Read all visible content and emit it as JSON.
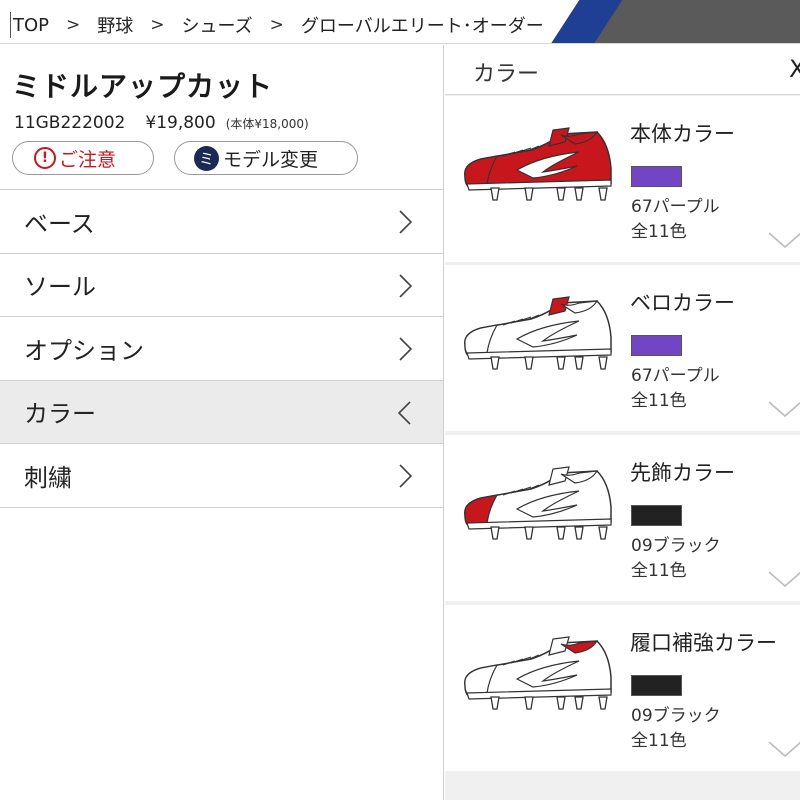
{
  "breadcrumb": [
    "TOP",
    "野球",
    "シューズ",
    "グローバルエリート･オーダー"
  ],
  "breadcrumb_separator": ">",
  "product": {
    "name": "ミドルアップカット",
    "code": "11GB222002",
    "price": "¥19,800",
    "base_price": "(本体¥18,000)"
  },
  "buttons": {
    "caution_label": "ご注意",
    "caution_icon": "!",
    "model_change_label": "モデル変更",
    "model_icon": "ミ"
  },
  "menu": {
    "items": [
      {
        "label": "ベース",
        "expanded": false
      },
      {
        "label": "ソール",
        "expanded": false
      },
      {
        "label": "オプション",
        "expanded": false
      },
      {
        "label": "カラー",
        "expanded": true
      },
      {
        "label": "刺繍",
        "expanded": false
      }
    ]
  },
  "panel": {
    "title": "カラー",
    "close_icon": "X"
  },
  "color_parts": [
    {
      "title": "本体カラー",
      "swatch_name": "67パープル",
      "swatch_color": "#7345c4",
      "count": "全11色",
      "highlight": "body"
    },
    {
      "title": "ベロカラー",
      "swatch_name": "67パープル",
      "swatch_color": "#7345c4",
      "count": "全11色",
      "highlight": "tongue"
    },
    {
      "title": "先飾カラー",
      "swatch_name": "09ブラック",
      "swatch_color": "#222222",
      "count": "全11色",
      "highlight": "toe"
    },
    {
      "title": "履口補強カラー",
      "swatch_name": "09ブラック",
      "swatch_color": "#222222",
      "count": "全11色",
      "highlight": "collar"
    }
  ],
  "colors": {
    "accent_red": "#c8161d",
    "header_blue": "#1f3f94",
    "active_bg": "#ebebeb"
  }
}
